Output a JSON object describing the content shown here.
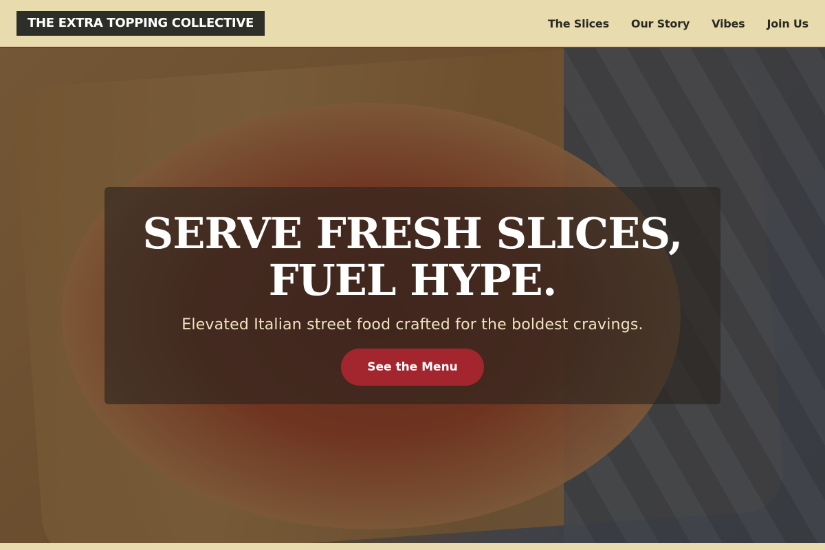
{
  "header": {
    "logo": "THE EXTRA TOPPING COLLECTIVE",
    "nav": [
      {
        "label": "The Slices"
      },
      {
        "label": "Our Story"
      },
      {
        "label": "Vibes"
      },
      {
        "label": "Join Us"
      }
    ]
  },
  "hero": {
    "headline_line1": "SERVE FRESH SLICES,",
    "headline_line2": "FUEL HYPE.",
    "subline": "Elevated Italian street food crafted for the boldest cravings.",
    "cta_label": "See the Menu"
  },
  "colors": {
    "accent": "#a3252e",
    "header_bg": "#e8dcae",
    "logo_bg": "#2e2e28"
  }
}
